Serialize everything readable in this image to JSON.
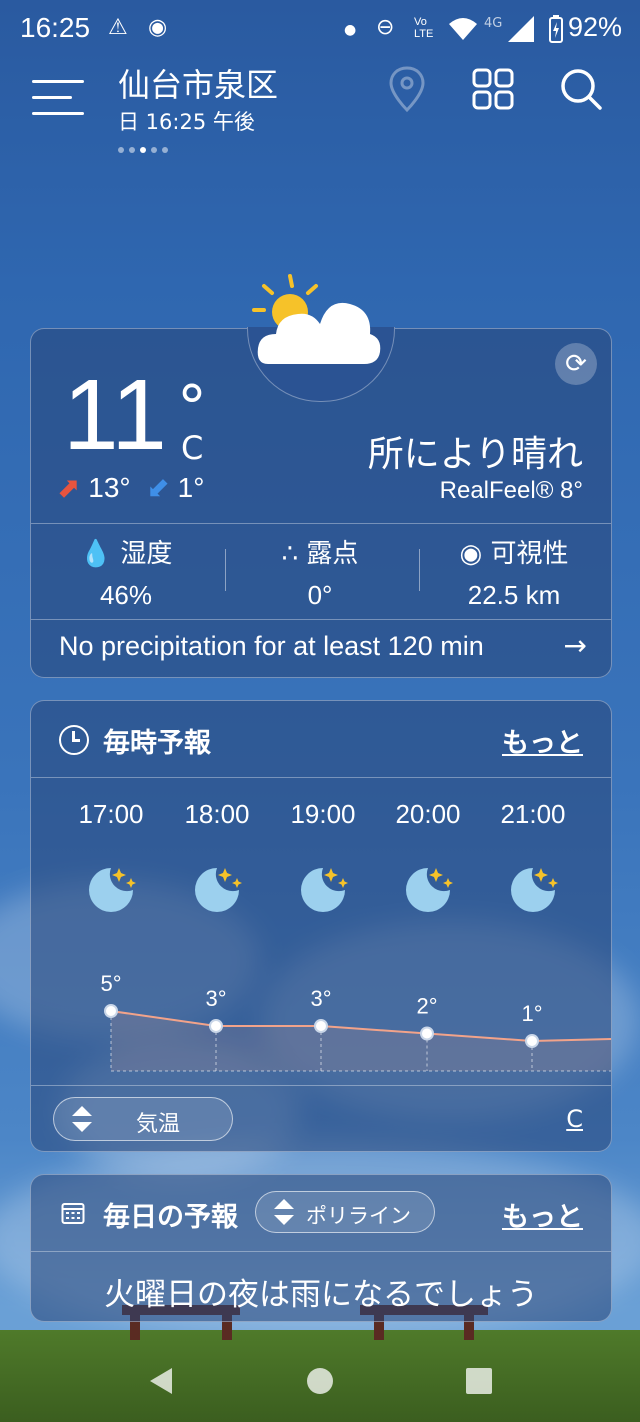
{
  "status_bar": {
    "time": "16:25",
    "battery": "92%",
    "network_lte": "LTE",
    "network_4g": "4G"
  },
  "header": {
    "city": "仙台市泉区",
    "subtitle": "日 16:25 午後"
  },
  "current": {
    "temperature": "11",
    "degree_symbol": "°",
    "unit": "C",
    "high": "13°",
    "low": "1°",
    "condition": "所により晴れ",
    "realfeel": "RealFeel® 8°",
    "humidity_label": "湿度",
    "humidity_value": "46%",
    "dewpoint_label": "露点",
    "dewpoint_value": "0°",
    "visibility_label": "可視性",
    "visibility_value": "22.5 km",
    "precip_message": "No precipitation for at least 120 min"
  },
  "hourly": {
    "title": "毎時予報",
    "more": "もっと",
    "hours": [
      {
        "time": "17:00",
        "temp": "5°",
        "value": 5
      },
      {
        "time": "18:00",
        "temp": "3°",
        "value": 3
      },
      {
        "time": "19:00",
        "temp": "3°",
        "value": 3
      },
      {
        "time": "20:00",
        "temp": "2°",
        "value": 2
      },
      {
        "time": "21:00",
        "temp": "1°",
        "value": 1
      }
    ],
    "metric_label": "気温",
    "unit_link": "C"
  },
  "daily": {
    "title": "毎日の予報",
    "mode": "ポリライン",
    "more": "もっと",
    "message": "火曜日の夜は雨になるでしょう"
  },
  "icons": {
    "menu": "menu-icon",
    "location": "location-pin-icon",
    "grid": "grid-icon",
    "search": "search-icon",
    "refresh": "refresh-icon"
  },
  "colors": {
    "accent_line": "#f2a38a",
    "high_arrow": "#e8543f",
    "low_arrow": "#3f8fe8"
  }
}
